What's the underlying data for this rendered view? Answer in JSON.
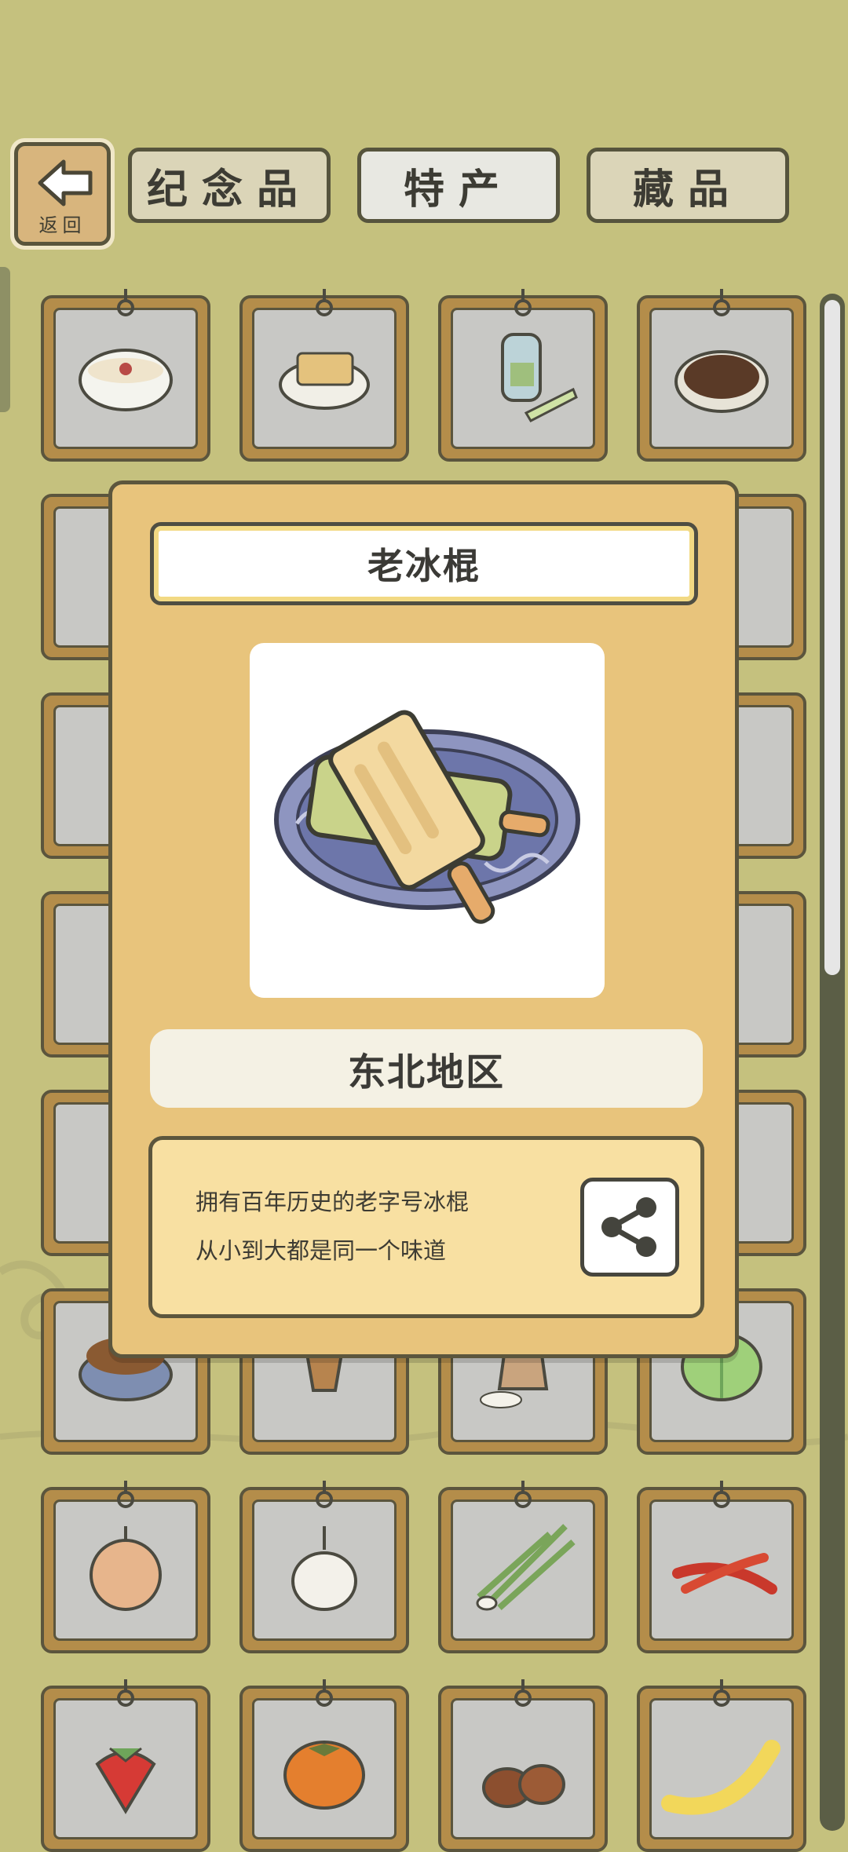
{
  "header": {
    "back_label": "返回",
    "tabs": [
      {
        "label": "纪念品",
        "active": false
      },
      {
        "label": "特产",
        "active": true
      },
      {
        "label": "藏品",
        "active": false
      }
    ]
  },
  "grid_items": [
    {
      "icon": "porridge-bowl-icon"
    },
    {
      "icon": "tofu-plate-icon"
    },
    {
      "icon": "tea-jar-icon"
    },
    {
      "icon": "beans-plate-icon"
    },
    {
      "icon": "item-icon"
    },
    {
      "icon": "item-icon"
    },
    {
      "icon": "item-icon"
    },
    {
      "icon": "item-icon"
    },
    {
      "icon": "item-icon"
    },
    {
      "icon": "item-icon"
    },
    {
      "icon": "item-icon"
    },
    {
      "icon": "item-icon"
    },
    {
      "icon": "item-icon"
    },
    {
      "icon": "item-icon"
    },
    {
      "icon": "item-icon"
    },
    {
      "icon": "item-icon"
    },
    {
      "icon": "item-icon"
    },
    {
      "icon": "item-icon"
    },
    {
      "icon": "item-icon"
    },
    {
      "icon": "item-icon"
    },
    {
      "icon": "nuts-bowl-icon"
    },
    {
      "icon": "pine-cone-icon"
    },
    {
      "icon": "rice-sack-icon"
    },
    {
      "icon": "cabbage-icon"
    },
    {
      "icon": "onion-icon"
    },
    {
      "icon": "garlic-icon"
    },
    {
      "icon": "scallion-icon"
    },
    {
      "icon": "chili-pepper-icon"
    },
    {
      "icon": "strawberry-icon"
    },
    {
      "icon": "persimmon-icon"
    },
    {
      "icon": "chestnut-icon"
    },
    {
      "icon": "banana-icon"
    }
  ],
  "popup": {
    "title": "老冰棍",
    "image_icon": "popsicle-plate-icon",
    "region": "东北地区",
    "description": [
      "拥有百年历史的老字号冰棍",
      "从小到大都是同一个味道"
    ],
    "share_icon": "share-icon"
  },
  "colors": {
    "background": "#c5c17e",
    "frame_wood": "#b48d4a",
    "frame_border": "#5b553d",
    "popup_bg": "#e8c47c",
    "desc_bg": "#f8e0a2"
  }
}
